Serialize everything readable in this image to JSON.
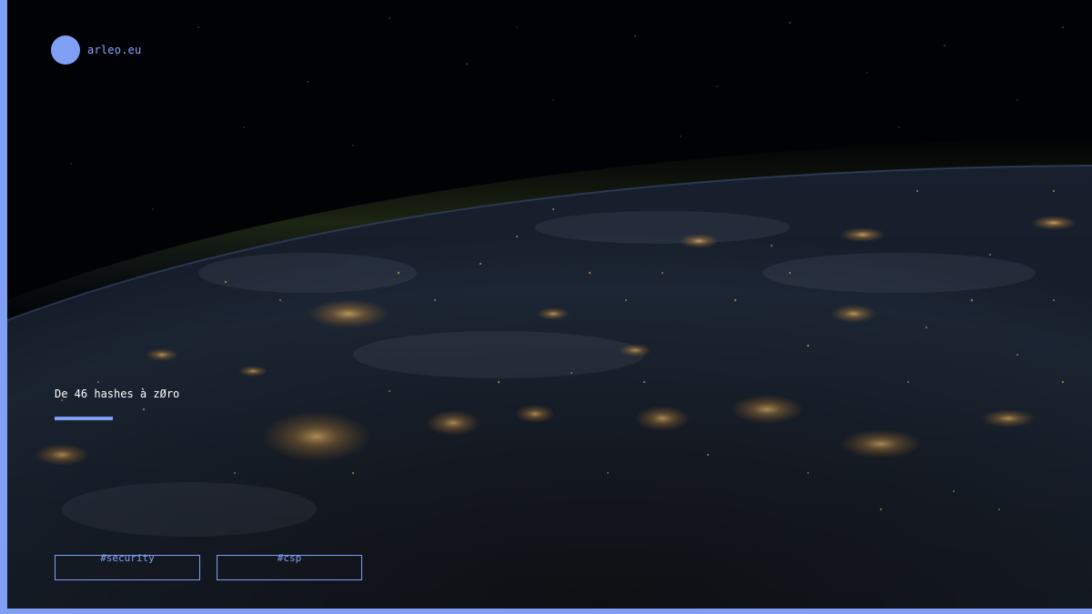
{
  "site": {
    "name": "arleo.eu",
    "accent_color": "#7f9ff5"
  },
  "background": {
    "subject": "earth-at-night-from-orbit-image"
  },
  "post": {
    "title": "De 46 hashes à zØro"
  },
  "tags": [
    {
      "label": "#security"
    },
    {
      "label": "#csp"
    }
  ]
}
